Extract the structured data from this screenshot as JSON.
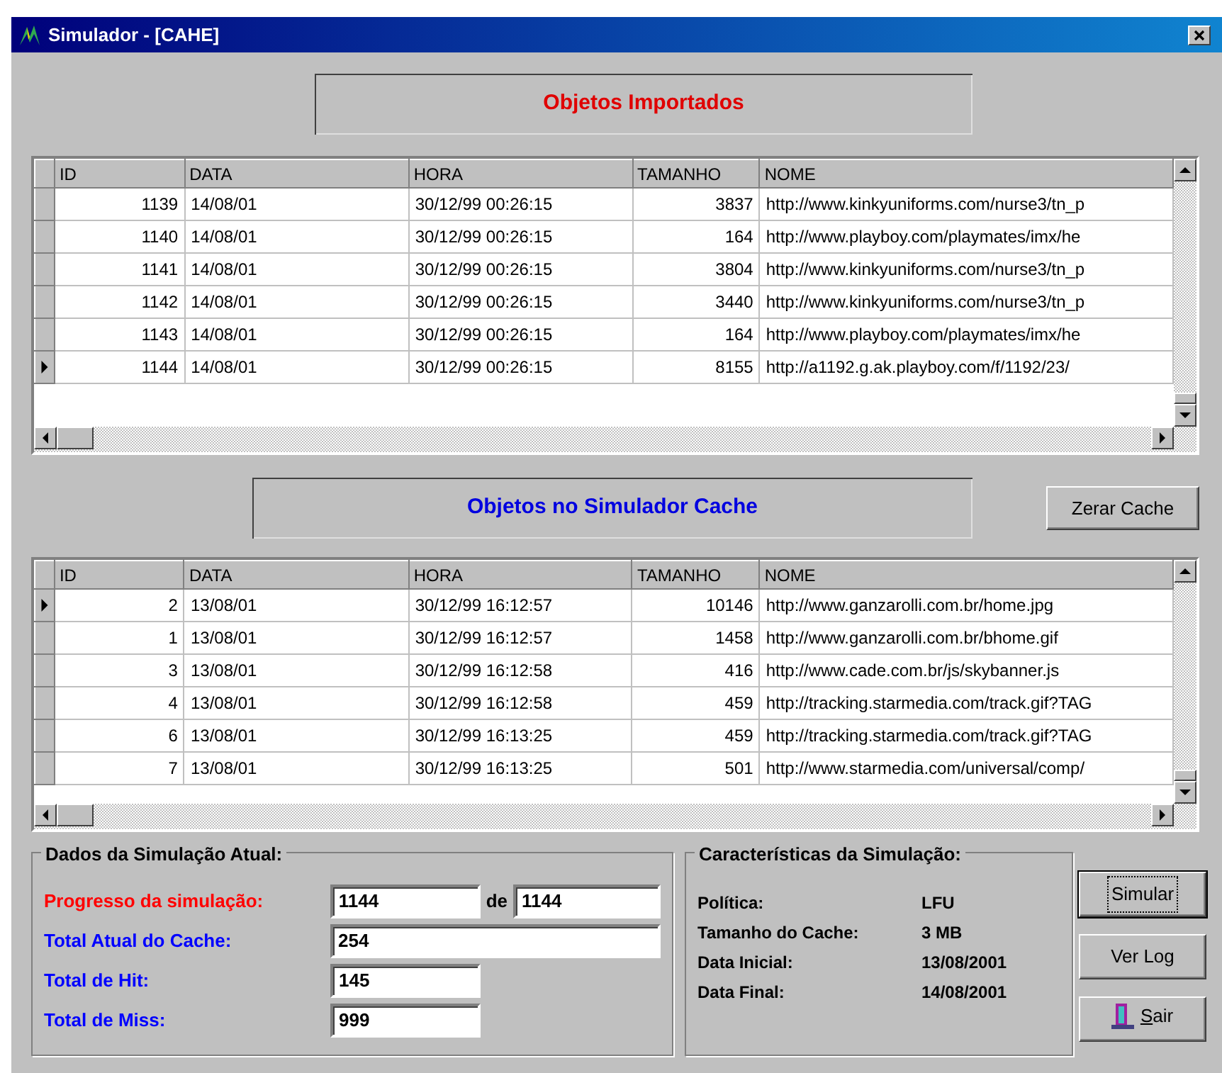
{
  "window": {
    "title": "Simulador - [CAHE]"
  },
  "imported": {
    "title": "Objetos Importados",
    "columns": [
      {
        "label": "ID",
        "kind": "number"
      },
      {
        "label": "DATA",
        "kind": "text"
      },
      {
        "label": "HORA",
        "kind": "text"
      },
      {
        "label": "TAMANHO",
        "kind": "number"
      },
      {
        "label": "NOME",
        "kind": "text"
      }
    ],
    "rows": [
      {
        "cells": [
          "1139",
          "14/08/01",
          "30/12/99 00:26:15",
          "3837",
          "http://www.kinkyuniforms.com/nurse3/tn_p"
        ],
        "selected": false
      },
      {
        "cells": [
          "1140",
          "14/08/01",
          "30/12/99 00:26:15",
          "164",
          "http://www.playboy.com/playmates/imx/he"
        ],
        "selected": false
      },
      {
        "cells": [
          "1141",
          "14/08/01",
          "30/12/99 00:26:15",
          "3804",
          "http://www.kinkyuniforms.com/nurse3/tn_p"
        ],
        "selected": false
      },
      {
        "cells": [
          "1142",
          "14/08/01",
          "30/12/99 00:26:15",
          "3440",
          "http://www.kinkyuniforms.com/nurse3/tn_p"
        ],
        "selected": false
      },
      {
        "cells": [
          "1143",
          "14/08/01",
          "30/12/99 00:26:15",
          "164",
          "http://www.playboy.com/playmates/imx/he"
        ],
        "selected": false
      },
      {
        "cells": [
          "1144",
          "14/08/01",
          "30/12/99 00:26:15",
          "8155",
          "http://a1192.g.ak.playboy.com/f/1192/23/"
        ],
        "selected": true
      }
    ]
  },
  "cache": {
    "title": "Objetos no Simulador Cache",
    "button": "Zerar Cache",
    "columns": [
      {
        "label": "ID",
        "kind": "number"
      },
      {
        "label": "DATA",
        "kind": "text"
      },
      {
        "label": "HORA",
        "kind": "text"
      },
      {
        "label": "TAMANHO",
        "kind": "number"
      },
      {
        "label": "NOME",
        "kind": "text"
      }
    ],
    "rows": [
      {
        "cells": [
          "2",
          "13/08/01",
          "30/12/99 16:12:57",
          "10146",
          "http://www.ganzarolli.com.br/home.jpg"
        ],
        "selected": true
      },
      {
        "cells": [
          "1",
          "13/08/01",
          "30/12/99 16:12:57",
          "1458",
          "http://www.ganzarolli.com.br/bhome.gif"
        ],
        "selected": false
      },
      {
        "cells": [
          "3",
          "13/08/01",
          "30/12/99 16:12:58",
          "416",
          "http://www.cade.com.br/js/skybanner.js"
        ],
        "selected": false
      },
      {
        "cells": [
          "4",
          "13/08/01",
          "30/12/99 16:12:58",
          "459",
          "http://tracking.starmedia.com/track.gif?TAG"
        ],
        "selected": false
      },
      {
        "cells": [
          "6",
          "13/08/01",
          "30/12/99 16:13:25",
          "459",
          "http://tracking.starmedia.com/track.gif?TAG"
        ],
        "selected": false
      },
      {
        "cells": [
          "7",
          "13/08/01",
          "30/12/99 16:13:25",
          "501",
          "http://www.starmedia.com/universal/comp/"
        ],
        "selected": false
      }
    ]
  },
  "current": {
    "title": "Dados da Simulação Atual:",
    "fields": [
      {
        "kind": "range",
        "label": "Progresso da simulação:",
        "color": "#ff0000",
        "value": "1144",
        "of_label": "de",
        "of_value": "1144"
      },
      {
        "kind": "wide",
        "label": "Total Atual do Cache:",
        "color": "#0000ff",
        "value": "254"
      },
      {
        "kind": "short",
        "label": "Total de Hit:",
        "color": "#0000ff",
        "value": "145"
      },
      {
        "kind": "short",
        "label": "Total de Miss:",
        "color": "#0000ff",
        "value": "999"
      }
    ]
  },
  "characteristics": {
    "title": "Características da Simulação:",
    "rows": [
      {
        "label": "Política:",
        "value": "LFU"
      },
      {
        "label": "Tamanho do Cache:",
        "value": "3 MB"
      },
      {
        "label": "Data Inicial:",
        "value": "13/08/2001"
      },
      {
        "label": "Data Final:",
        "value": "14/08/2001"
      }
    ]
  },
  "buttons": [
    {
      "label": "Simular",
      "kind": "plain",
      "focused": true
    },
    {
      "label": "Ver Log",
      "kind": "plain",
      "focused": false
    },
    {
      "label": "Sair",
      "kind": "exit",
      "focused": false
    }
  ]
}
